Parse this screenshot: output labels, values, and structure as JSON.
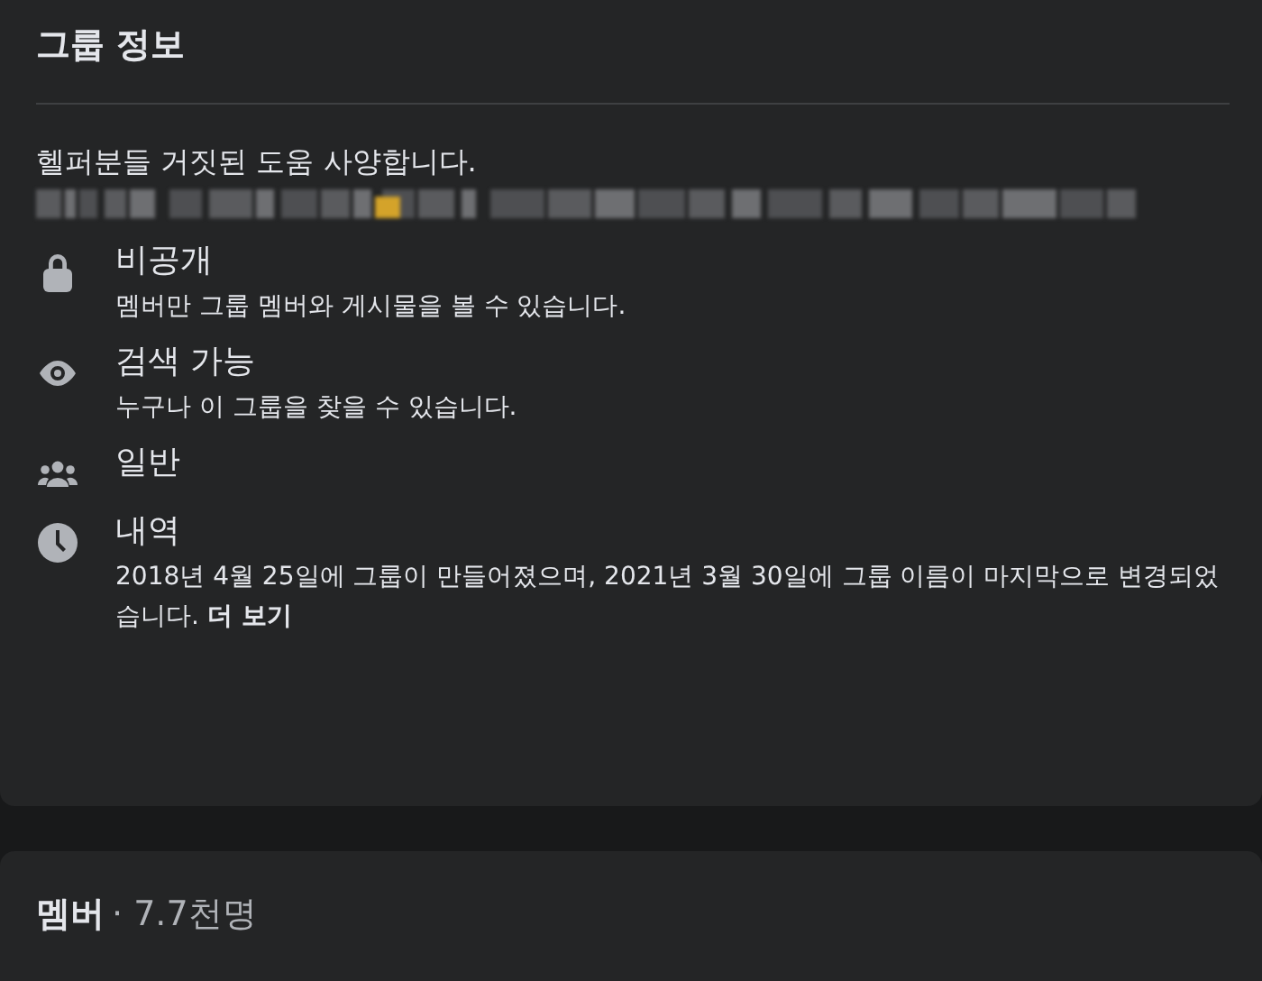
{
  "about": {
    "title": "그룹 정보",
    "description": "헬퍼분들 거짓된 도움 사양합니다.",
    "items": [
      {
        "kind": "lock",
        "title": "비공개",
        "text": "멤버만 그룹 멤버와 게시물을 볼 수 있습니다."
      },
      {
        "kind": "eye",
        "title": "검색 가능",
        "text": "누구나 이 그룹을 찾을 수 있습니다."
      },
      {
        "kind": "people",
        "title": "일반"
      },
      {
        "kind": "clock",
        "title": "내역",
        "text": "2018년 4월 25일에 그룹이 만들어졌으며, 2021년 3월 30일에 그룹 이름이 마지막으로 변경되었습니다.",
        "link": "더 보기"
      }
    ]
  },
  "members": {
    "title": "멤버",
    "count": "· 7.7천명"
  }
}
